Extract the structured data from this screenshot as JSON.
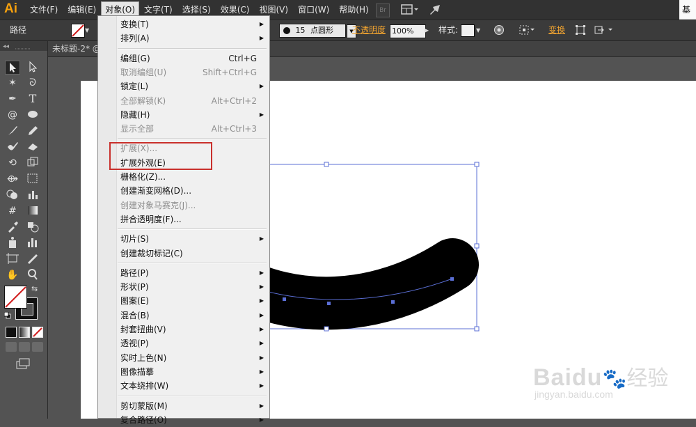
{
  "app": {
    "logo": "Ai",
    "right_edge_text": "基"
  },
  "menubar": {
    "items": [
      "文件(F)",
      "编辑(E)",
      "对象(O)",
      "文字(T)",
      "选择(S)",
      "效果(C)",
      "视图(V)",
      "窗口(W)",
      "帮助(H)"
    ],
    "active_index": 2,
    "bridge_icon": "Br"
  },
  "optionsbar": {
    "selection_type": "路径",
    "brush_size": "15",
    "brush_name": "点圆形",
    "opacity_label": "不透明度",
    "opacity_value": "100%",
    "style_label": "样式:",
    "transform_label": "变换"
  },
  "document_tab": {
    "title": "未标题-2* @"
  },
  "object_menu": [
    {
      "label": "变换(T)",
      "submenu": true,
      "disabled": false
    },
    {
      "label": "排列(A)",
      "submenu": true,
      "disabled": false
    },
    {
      "separator": true
    },
    {
      "label": "编组(G)",
      "shortcut": "Ctrl+G",
      "disabled": false
    },
    {
      "label": "取消编组(U)",
      "shortcut": "Shift+Ctrl+G",
      "disabled": true
    },
    {
      "label": "锁定(L)",
      "submenu": true,
      "disabled": false
    },
    {
      "label": "全部解锁(K)",
      "shortcut": "Alt+Ctrl+2",
      "disabled": true
    },
    {
      "label": "隐藏(H)",
      "submenu": true,
      "disabled": false
    },
    {
      "label": "显示全部",
      "shortcut": "Alt+Ctrl+3",
      "disabled": true
    },
    {
      "separator": true
    },
    {
      "label": "扩展(X)...",
      "disabled": true
    },
    {
      "label": "扩展外观(E)",
      "disabled": false
    },
    {
      "label": "栅格化(Z)...",
      "disabled": false
    },
    {
      "label": "创建渐变网格(D)...",
      "disabled": false
    },
    {
      "label": "创建对象马赛克(J)...",
      "disabled": true
    },
    {
      "label": "拼合透明度(F)...",
      "disabled": false
    },
    {
      "separator": true
    },
    {
      "label": "切片(S)",
      "submenu": true,
      "disabled": false
    },
    {
      "label": "创建裁切标记(C)",
      "disabled": false
    },
    {
      "separator": true
    },
    {
      "label": "路径(P)",
      "submenu": true,
      "disabled": false
    },
    {
      "label": "形状(P)",
      "submenu": true,
      "disabled": false
    },
    {
      "label": "图案(E)",
      "submenu": true,
      "disabled": false
    },
    {
      "label": "混合(B)",
      "submenu": true,
      "disabled": false
    },
    {
      "label": "封套扭曲(V)",
      "submenu": true,
      "disabled": false
    },
    {
      "label": "透视(P)",
      "submenu": true,
      "disabled": false
    },
    {
      "label": "实时上色(N)",
      "submenu": true,
      "disabled": false
    },
    {
      "label": "图像描摹",
      "submenu": true,
      "disabled": false
    },
    {
      "label": "文本绕排(W)",
      "submenu": true,
      "disabled": false
    },
    {
      "separator": true
    },
    {
      "label": "剪切蒙版(M)",
      "submenu": true,
      "disabled": false
    },
    {
      "label": "复合路径(O)",
      "submenu": true,
      "disabled": false
    }
  ],
  "colors": {
    "accent_highlight": "#c9302c",
    "link_orange": "#f0a330",
    "stroke_black": "#000000",
    "path_blue": "#5b6fd6"
  },
  "watermark": {
    "brand": "Baidu",
    "brand_cn": "经验",
    "url": "jingyan.baidu.com"
  }
}
